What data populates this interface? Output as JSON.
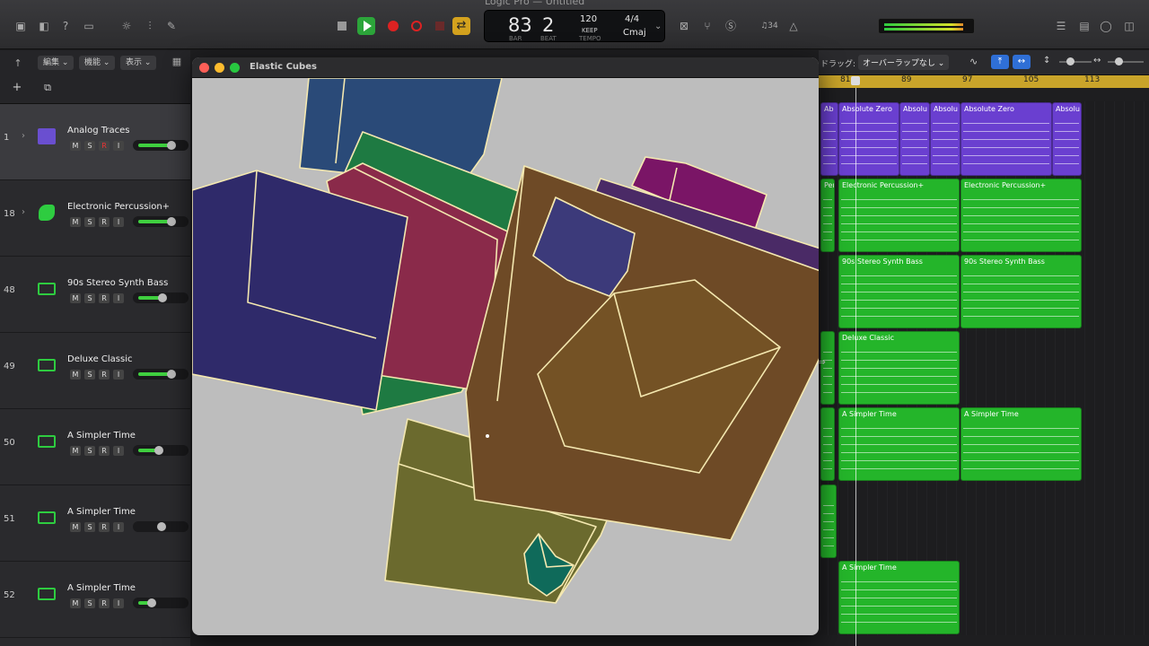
{
  "window": {
    "title": "Logic Pro — Untitled"
  },
  "lcd": {
    "bar": "83",
    "beat": "2",
    "bar_label": "BAR",
    "beat_label": "BEAT",
    "tempo": "120",
    "keep": "KEEP",
    "tempo_label": "TEMPO",
    "signature": "4/4",
    "key": "Cmaj"
  },
  "toolbar": {
    "counter": "♫34"
  },
  "menus": {
    "edit": "編集 ⌄",
    "function": "機能 ⌄",
    "view": "表示 ⌄"
  },
  "arrange_toolbar": {
    "drag_label": "ドラッグ:",
    "drag_mode": "オーバーラップなし ⌄"
  },
  "ruler": {
    "marks": [
      "81",
      "89",
      "97",
      "105",
      "113"
    ]
  },
  "tracks": [
    {
      "num": "1",
      "name": "Analog Traces",
      "icon": "synth-icon"
    },
    {
      "num": "18",
      "name": "Electronic Percussion+",
      "icon": "drum-icon"
    },
    {
      "num": "48",
      "name": "90s Stereo Synth Bass",
      "icon": "keyboard-icon"
    },
    {
      "num": "49",
      "name": "Deluxe Classic",
      "icon": "keyboard-icon"
    },
    {
      "num": "50",
      "name": "A Simpler Time",
      "icon": "keyboard-icon"
    },
    {
      "num": "51",
      "name": "A Simpler Time",
      "icon": "keyboard-icon"
    },
    {
      "num": "52",
      "name": "A Simpler Time",
      "icon": "keyboard-icon"
    }
  ],
  "msri": [
    "M",
    "S",
    "R",
    "I"
  ],
  "regions": {
    "r1a": "Ab",
    "r1b": "Absolute Zero",
    "r1c": "Absolu",
    "r1d": "Absolu",
    "r1e": "Absolute Zero",
    "r1f": "Absolu",
    "r2a": "Per",
    "r2b": "Electronic Percussion+",
    "r2c": "Electronic Percussion+",
    "r3a": "90s Stereo Synth Bass",
    "r3b": "90s Stereo Synth Bass",
    "r4a": "Deluxe Classic",
    "r5a": "A Simpler Time",
    "r5b": "A Simpler Time",
    "r7a": "A Simpler Time"
  },
  "plugin": {
    "title": "Elastic Cubes"
  },
  "colors": {
    "accent_green": "#24b52a",
    "accent_purple": "#6a3fd0",
    "ruler": "#c9a42a"
  }
}
